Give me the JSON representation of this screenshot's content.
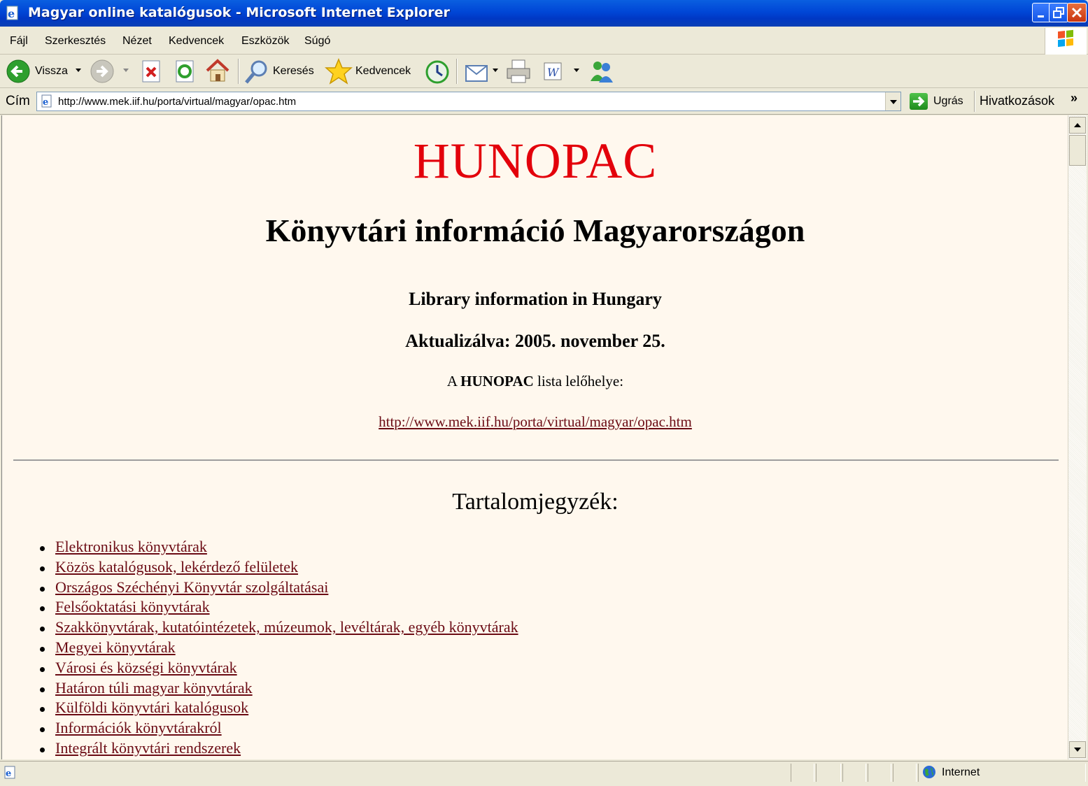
{
  "window": {
    "title": "Magyar online katalógusok - Microsoft Internet Explorer"
  },
  "menu": [
    "Fájl",
    "Szerkesztés",
    "Nézet",
    "Kedvencek",
    "Eszközök",
    "Súgó"
  ],
  "toolbar": {
    "back_label": "Vissza",
    "search_label": "Keresés",
    "favorites_label": "Kedvencek"
  },
  "address": {
    "label": "Cím",
    "url": "http://www.mek.iif.hu/porta/virtual/magyar/opac.htm",
    "go_label": "Ugrás",
    "links_label": "Hivatkozások",
    "links_chevron": "»"
  },
  "page": {
    "title": "HUNOPAC",
    "heading": "Könyvtári információ Magyarországon",
    "subheading": "Library information in Hungary",
    "updated": "Aktualizálva: 2005. november 25.",
    "source_prefix": "A ",
    "source_bold": "HUNOPAC",
    "source_suffix": " lista lelőhelye:",
    "source_url": "http://www.mek.iif.hu/porta/virtual/magyar/opac.htm",
    "toc_title": "Tartalomjegyzék:",
    "toc": [
      "Elektronikus könyvtárak",
      "Közös katalógusok, lekérdező felületek",
      "Országos Széchényi Könyvtár szolgáltatásai",
      "Felsőoktatási könyvtárak",
      "Szakkönyvtárak, kutatóintézetek, múzeumok, levéltárak, egyéb könyvtárak",
      "Megyei könyvtárak",
      "Városi és községi könyvtárak",
      "Határon túli magyar könyvtárak",
      "Külföldi könyvtári katalógusok",
      "Információk könyvtárakról",
      "Integrált könyvtári rendszerek"
    ]
  },
  "status": {
    "zone": "Internet"
  },
  "colors": {
    "title_red": "#e3000b",
    "link": "#6b0b14",
    "page_bg": "#fff8ee"
  }
}
